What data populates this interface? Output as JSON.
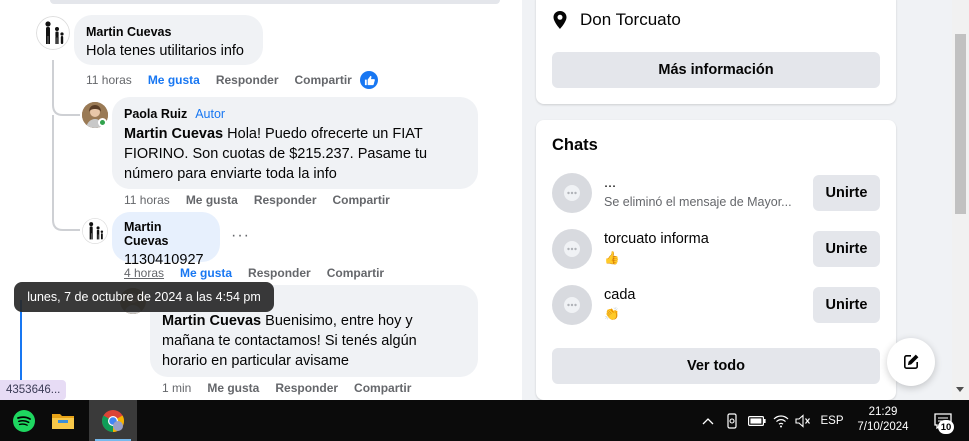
{
  "comments": [
    {
      "author": "Martin Cuevas",
      "text": "Hola tenes utilitarios info",
      "time": "11 horas",
      "like": "Me gusta",
      "reply": "Responder",
      "share": "Compartir"
    },
    {
      "author": "Paola Ruiz",
      "badge": "Autor",
      "mention": "Martin Cuevas",
      "line1": " Hola! Puedo ofrecerte un FIAT",
      "line2": "FIORINO. Son cuotas de $215.237. Pasame tu",
      "line3": "número para enviarte toda la info",
      "time": "11 horas",
      "like": "Me gusta",
      "reply": "Responder",
      "share": "Compartir"
    },
    {
      "author": "Martin Cuevas",
      "text": "1130410927",
      "time": "4 horas",
      "like": "Me gusta",
      "reply": "Responder",
      "share": "Compartir"
    },
    {
      "mention": "Martin Cuevas",
      "line1": " Buenisimo, entre hoy y",
      "line2": "mañana te contactamos! Si tenés algún",
      "line3": "horario en particular avisame",
      "time": "1 min",
      "like": "Me gusta",
      "reply": "Responder",
      "share": "Compartir"
    }
  ],
  "tooltip": "lunes, 7 de octubre de 2024 a las 4:54 pm",
  "id_chip": "4353646...",
  "sidebar": {
    "location": "Don Torcuato",
    "more_info": "Más información",
    "chats_title": "Chats",
    "chats": [
      {
        "name": "...",
        "sub": "Se eliminó el mensaje de Mayor...",
        "join": "Unirte"
      },
      {
        "name": "torcuato informa",
        "sub": "👍",
        "join": "Unirte"
      },
      {
        "name": "cada",
        "sub": "👏",
        "join": "Unirte"
      }
    ],
    "see_all": "Ver todo"
  },
  "taskbar": {
    "lang": "ESP",
    "time": "21:29",
    "date": "7/10/2024",
    "notifications": "10"
  },
  "icons": {
    "location": "location-pin-icon",
    "like_reaction": "thumbs-up-icon",
    "chat": "chat-bubble-icon",
    "compose": "compose-icon"
  },
  "colors": {
    "accent": "#1877f2",
    "bubble": "#f0f2f5",
    "button": "#e4e6eb"
  }
}
